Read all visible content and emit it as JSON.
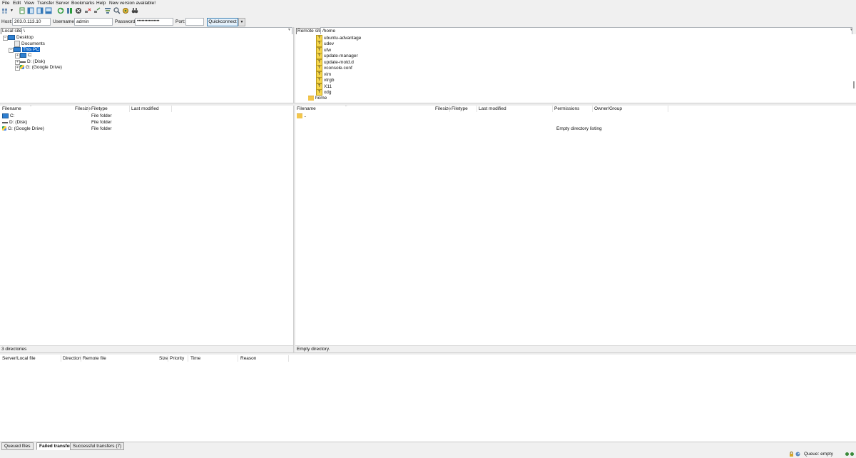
{
  "menu": [
    "File",
    "Edit",
    "View",
    "Transfer",
    "Server",
    "Bookmarks",
    "Help",
    "New version available!"
  ],
  "quickconnect": {
    "host_label": "Host:",
    "host_value": "203.0.113.10",
    "username_label": "Username:",
    "username_value": "admin",
    "password_label": "Password:",
    "password_value": "•••••••••••••••",
    "port_label": "Port:",
    "port_value": "",
    "button": "Quickconnect"
  },
  "local": {
    "site_label": "Local site:",
    "site_path": "\\",
    "tree": [
      {
        "label": "Desktop"
      },
      {
        "label": "Documents"
      },
      {
        "label": "This PC"
      },
      {
        "label": "C:"
      },
      {
        "label": "D: (Disk)"
      },
      {
        "label": "G: (Google Drive)"
      }
    ],
    "columns": [
      "Filename",
      "Filesize",
      "Filetype",
      "Last modified"
    ],
    "rows": [
      {
        "name": "C:",
        "type": "File folder"
      },
      {
        "name": "D: (Disk)",
        "type": "File folder"
      },
      {
        "name": "G: (Google Drive)",
        "type": "File folder"
      }
    ],
    "status": "3 directories"
  },
  "remote": {
    "site_label": "Remote site:",
    "site_path": "/home",
    "tree": [
      "ubuntu-advantage",
      "udev",
      "ufw",
      "update-manager",
      "update-motd.d",
      "vconsole.conf",
      "vim",
      "vtrgb",
      "X11",
      "xdg",
      "home"
    ],
    "columns": [
      "Filename",
      "Filesize",
      "Filetype",
      "Last modified",
      "Permissions",
      "Owner/Group"
    ],
    "parent_row": "..",
    "empty_message": "Empty directory listing",
    "status": "Empty directory."
  },
  "queue": {
    "columns": [
      "Server/Local file",
      "Direction",
      "Remote file",
      "Size",
      "Priority",
      "Time",
      "Reason"
    ],
    "tabs": [
      "Queued files",
      "Failed transfers",
      "Successful transfers (7)"
    ],
    "status": "Queue: empty"
  },
  "colors": {
    "selection": "#0a64c8",
    "folder": "#f3c64b"
  }
}
